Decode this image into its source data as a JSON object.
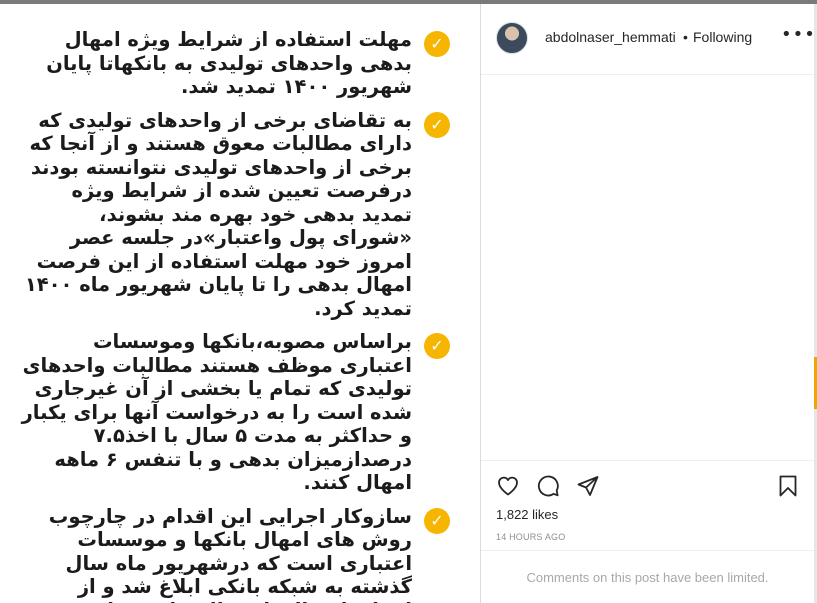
{
  "post": {
    "bullets": [
      {
        "text": "مهلت استفاده از شرایط ویژه امهال بدهی واحدهای تولیدی به بانکهاتا پایان شهریور ۱۴۰۰ تمدید شد."
      },
      {
        "text": "به تقاضای برخی از واحدهای تولیدی که دارای مطالبات معوق هستند و از آنجا که برخی از واحدهای تولیدی نتوانسته بودند درفرصت تعیین شده از شرایط ویژه تمدید بدهی خود بهره مند بشوند، «شورای پول واعتبار»در جلسه عصر امروز خود مهلت استفاده از این فرصت امهال بدهی را تا پایان شهریور ماه ۱۴۰۰ تمدید کرد."
      },
      {
        "text": "براساس مصوبه،بانکها وموسسات اعتباری موظف هستند مطالبات واحدهای تولیدی که تمام یا بخشی از آن غیرجاری شده است را به درخواست آنها برای یکبار و حداکثر به مدت ۵ سال با اخذ۷.۵ درصدازمیزان بدهی و با تنفس ۶ ماهه امهال کنند."
      },
      {
        "text": "سازوکار اجرایی این اقدام در چارچوب روش های امهال بانکها و موسسات اعتباری است که درشهریور ماه  سال گذشته به شبکه بانکی ابلاغ شد و از ابتدای امسال، لازم الاجرا شده است ."
      }
    ],
    "check_icon": "check-circle-icon",
    "accent_color": "#f6b500"
  },
  "header": {
    "username": "abdolnaser_hemmati",
    "separator": "•",
    "follow_status": "Following",
    "more_icon": "more-horizontal-icon"
  },
  "actions": {
    "icons": [
      "heart-icon",
      "comment-icon",
      "share-icon",
      "bookmark-icon"
    ]
  },
  "likes": "1,822 likes",
  "timestamp": "14 HOURS AGO",
  "comments_notice": "Comments on this post have been limited."
}
